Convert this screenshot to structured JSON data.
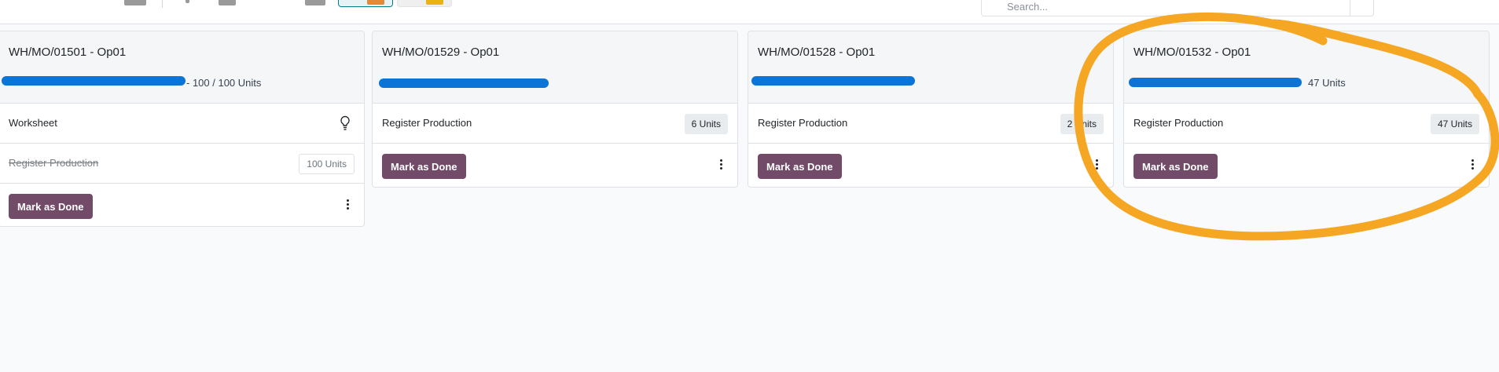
{
  "search": {
    "placeholder": "Search..."
  },
  "colors": {
    "accent": "#714b67",
    "teal": "#017e84",
    "annotation": "#f5a623",
    "redaction": "#0b74d6"
  },
  "cards": [
    {
      "title": "WH/MO/01501 - Op01",
      "subtitle_suffix": "- 100 / 100 Units",
      "rows": [
        {
          "label": "Worksheet",
          "icon": "lightbulb-icon"
        },
        {
          "label": "Register Production",
          "badge": "100 Units",
          "done": true
        }
      ],
      "action": "Mark as Done"
    },
    {
      "title": "WH/MO/01529 - Op01",
      "subtitle_suffix": "",
      "rows": [
        {
          "label": "Register Production",
          "badge": "6 Units"
        }
      ],
      "action": "Mark as Done"
    },
    {
      "title": "WH/MO/01528 - Op01",
      "subtitle_suffix": "",
      "rows": [
        {
          "label": "Register Production",
          "badge": "2 Units"
        }
      ],
      "action": "Mark as Done"
    },
    {
      "title": "WH/MO/01532 - Op01",
      "subtitle_suffix": "47 Units",
      "rows": [
        {
          "label": "Register Production",
          "badge": "47 Units"
        }
      ],
      "action": "Mark as Done"
    }
  ]
}
